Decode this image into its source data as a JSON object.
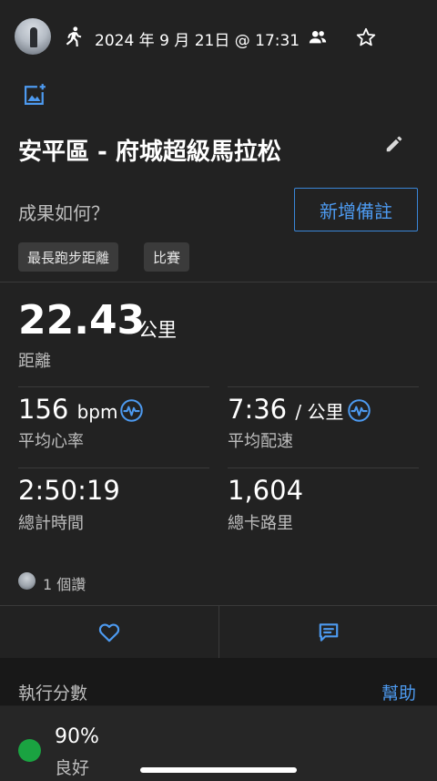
{
  "header": {
    "activity_icon": "running-person-icon",
    "date_time": "2024 年 9 月 21日 @ 17:31",
    "people_icon": "people-icon",
    "star_icon": "star-icon"
  },
  "add_photo_icon": "add-photo-icon",
  "activity": {
    "title": "安平區 - 府城超級馬拉松",
    "edit_icon": "pencil-icon"
  },
  "note": {
    "question": "成果如何？",
    "add_note_label": "新增備註"
  },
  "tags": [
    "最長跑步距離",
    "比賽"
  ],
  "distance": {
    "value": "22.43",
    "unit": "公里",
    "label": "距離"
  },
  "stats": [
    {
      "value": "156",
      "unit": "bpm",
      "label": "平均心率",
      "icon": "activity-pulse-icon"
    },
    {
      "value": "7:36",
      "unit": "/ 公里",
      "label": "平均配速",
      "icon": "activity-pulse-icon"
    },
    {
      "value": "2:50:19",
      "unit": "",
      "label": "總計時間"
    },
    {
      "value": "1,604",
      "unit": "",
      "label": "總卡路里"
    }
  ],
  "likes": {
    "text": "1 個讚"
  },
  "actions": {
    "like_icon": "heart-icon",
    "comment_icon": "comment-icon"
  },
  "execution_score": {
    "section_title": "執行分數",
    "help_label": "幫助",
    "value": "90%",
    "label": "良好",
    "color": "#1aa341"
  },
  "colors": {
    "accent": "#4d9af0",
    "background": "#222222"
  }
}
